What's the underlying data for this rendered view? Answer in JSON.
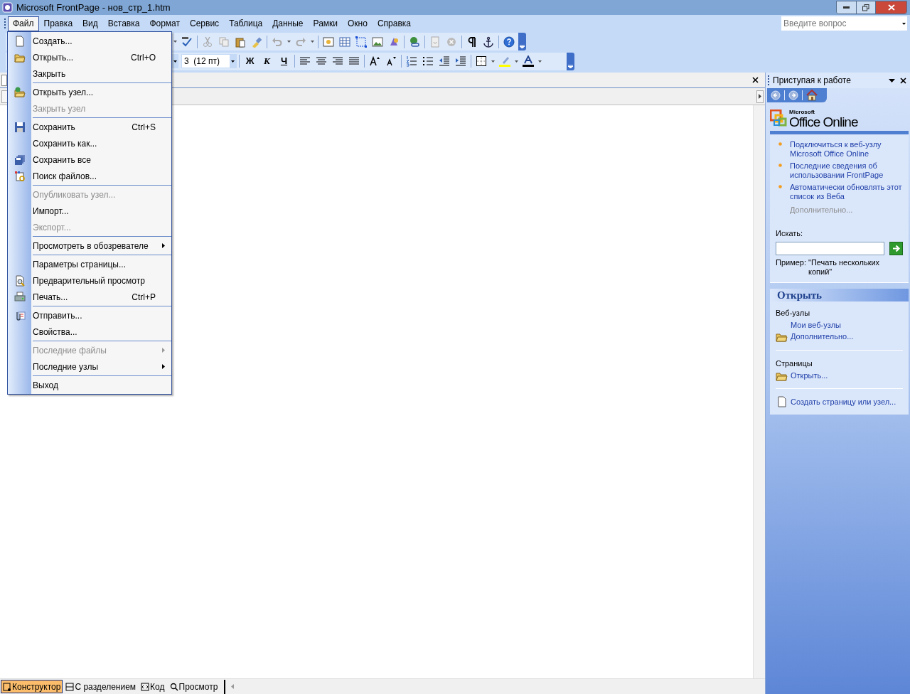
{
  "window": {
    "title": "Microsoft FrontPage - нов_стр_1.htm"
  },
  "menubar": [
    {
      "label": "Файл",
      "selected": true
    },
    {
      "label": "Правка",
      "selected": false
    },
    {
      "label": "Вид",
      "selected": false
    },
    {
      "label": "Вставка",
      "selected": false
    },
    {
      "label": "Формат",
      "selected": false
    },
    {
      "label": "Сервис",
      "selected": false
    },
    {
      "label": "Таблица",
      "selected": false
    },
    {
      "label": "Данные",
      "selected": false
    },
    {
      "label": "Рамки",
      "selected": false
    },
    {
      "label": "Окно",
      "selected": false
    },
    {
      "label": "Справка",
      "selected": false
    }
  ],
  "help_search": {
    "placeholder": "Введите вопрос"
  },
  "formatting_toolbar": {
    "font_size": "3  (12 пт)",
    "bold": "Ж",
    "italic": "К",
    "underline": "Ч"
  },
  "file_menu": [
    {
      "kind": "item",
      "label": "Создать...",
      "disabled": false,
      "submenu": false
    },
    {
      "kind": "item",
      "label": "Открыть...",
      "shortcut": "Ctrl+O",
      "disabled": false,
      "submenu": false
    },
    {
      "kind": "item",
      "label": "Закрыть",
      "disabled": false,
      "submenu": false
    },
    {
      "kind": "separator"
    },
    {
      "kind": "item",
      "label": "Открыть узел...",
      "disabled": false,
      "submenu": false
    },
    {
      "kind": "item",
      "label": "Закрыть узел",
      "disabled": true,
      "submenu": false
    },
    {
      "kind": "separator"
    },
    {
      "kind": "item",
      "label": "Сохранить",
      "shortcut": "Ctrl+S",
      "disabled": false,
      "submenu": false
    },
    {
      "kind": "item",
      "label": "Сохранить как...",
      "disabled": false,
      "submenu": false
    },
    {
      "kind": "item",
      "label": "Сохранить все",
      "disabled": false,
      "submenu": false
    },
    {
      "kind": "item",
      "label": "Поиск файлов...",
      "disabled": false,
      "submenu": false
    },
    {
      "kind": "separator"
    },
    {
      "kind": "item",
      "label": "Опубликовать узел...",
      "disabled": true,
      "submenu": false
    },
    {
      "kind": "item",
      "label": "Импорт...",
      "disabled": false,
      "submenu": false
    },
    {
      "kind": "item",
      "label": "Экспорт...",
      "disabled": true,
      "submenu": false
    },
    {
      "kind": "separator"
    },
    {
      "kind": "item",
      "label": "Просмотреть в обозревателе",
      "disabled": false,
      "submenu": true
    },
    {
      "kind": "separator"
    },
    {
      "kind": "item",
      "label": "Параметры страницы...",
      "disabled": false,
      "submenu": false
    },
    {
      "kind": "item",
      "label": "Предварительный просмотр",
      "disabled": false,
      "submenu": false
    },
    {
      "kind": "item",
      "label": "Печать...",
      "shortcut": "Ctrl+P",
      "disabled": false,
      "submenu": false
    },
    {
      "kind": "separator"
    },
    {
      "kind": "item",
      "label": "Отправить...",
      "disabled": false,
      "submenu": false
    },
    {
      "kind": "item",
      "label": "Свойства...",
      "disabled": false,
      "submenu": false
    },
    {
      "kind": "separator"
    },
    {
      "kind": "item",
      "label": "Последние файлы",
      "disabled": true,
      "submenu": true
    },
    {
      "kind": "item",
      "label": "Последние узлы",
      "disabled": false,
      "submenu": true
    },
    {
      "kind": "separator"
    },
    {
      "kind": "item",
      "label": "Выход",
      "disabled": false,
      "submenu": false
    }
  ],
  "task_pane": {
    "title": "Приступая к работе",
    "logo": {
      "small": "Microsoft",
      "large": "Office Online"
    },
    "links": [
      {
        "label": "Подключиться к веб-узлу Microsoft Office Online",
        "disabled": false
      },
      {
        "label": "Последние сведения об использовании FrontPage",
        "disabled": false
      },
      {
        "label": "Автоматически обновлять этот список из Веба",
        "disabled": false
      }
    ],
    "more": {
      "label": "Дополнительно...",
      "disabled": true
    },
    "search_label": "Искать:",
    "example_label": "Пример:",
    "example": "\"Печать нескольких копий\"",
    "open_section": {
      "title": "Открыть",
      "groups": [
        {
          "heading": "Веб-узлы",
          "links": [
            {
              "label": "Мои веб-узлы",
              "icon": false
            },
            {
              "label": "Дополнительно...",
              "icon": true
            }
          ]
        },
        {
          "heading": "Страницы",
          "links": [
            {
              "label": "Открыть...",
              "icon": true
            }
          ]
        }
      ],
      "create": "Создать страницу или узел..."
    }
  },
  "view_tabs": [
    {
      "label": "Конструктор",
      "selected": true
    },
    {
      "label": "С разделением",
      "selected": false
    },
    {
      "label": "Код",
      "selected": false
    },
    {
      "label": "Просмотр",
      "selected": false
    }
  ]
}
